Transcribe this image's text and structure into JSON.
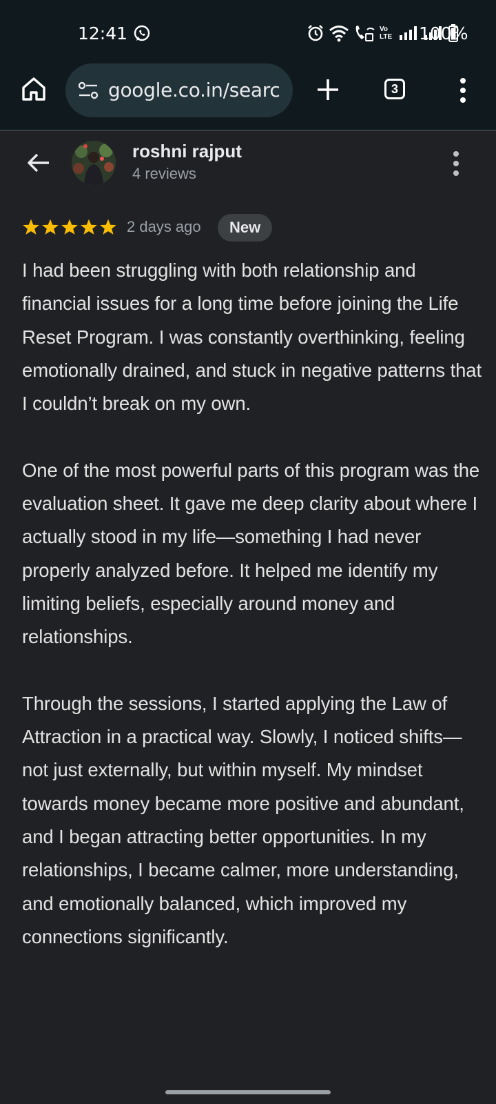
{
  "status_bar": {
    "time": "12:41",
    "volte_label": "Vo LTE",
    "battery_percent": "100%",
    "icons": [
      "whatsapp-icon",
      "alarm-icon",
      "wifi-icon",
      "wifi-call-icon",
      "volte-icon",
      "signal-icon",
      "signal-icon",
      "battery-icon"
    ]
  },
  "browser": {
    "url": "google.co.in/search",
    "tab_count": "3",
    "icons": [
      "home-icon",
      "tune-icon",
      "plus-icon",
      "tabs-icon",
      "menu-icon"
    ]
  },
  "review": {
    "reviewer_name": "roshni rajput",
    "review_count": "4 reviews",
    "rating": 5,
    "date": "2 days ago",
    "badge": "New",
    "paragraphs": [
      "I had been struggling with both relationship and financial issues for a long time before joining the Life Reset Program. I was constantly overthinking, feeling emotionally drained, and stuck in negative patterns that I couldn’t break on my own.",
      "One of the most powerful parts of this program was the evaluation sheet. It gave me deep clarity about where I actually stood in my life—something I had never properly analyzed before. It helped me identify my limiting beliefs, especially around money and relationships.",
      "Through the sessions, I started applying the Law of Attraction in a practical way. Slowly, I noticed shifts—not just externally, but within myself. My mindset towards money became more positive and abundant, and I began attracting better opportunities. In my relationships, I became calmer, more understanding, and emotionally balanced, which improved my connections significantly."
    ]
  },
  "colors": {
    "star": "#fbbc04",
    "background": "#202124",
    "toolbar": "#101a1e"
  }
}
